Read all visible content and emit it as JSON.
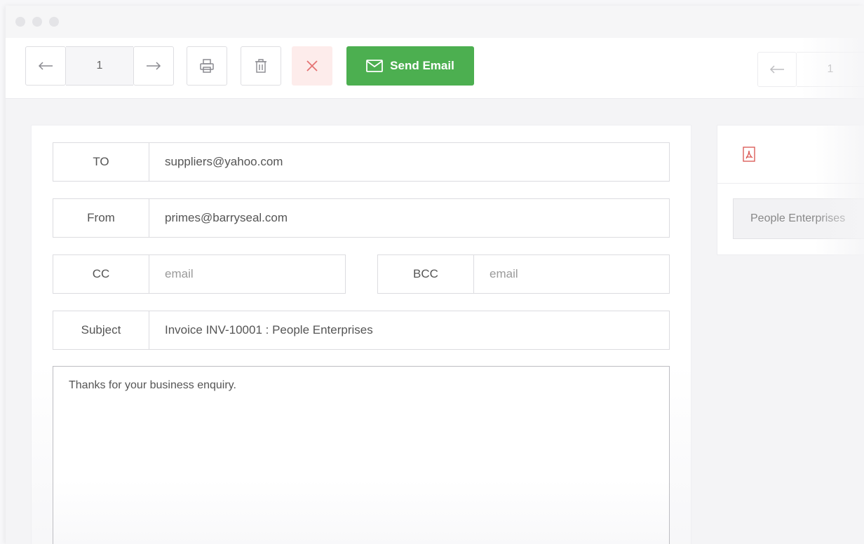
{
  "toolbar": {
    "page_number": "1",
    "send_label": "Send Email",
    "preview_page_number": "1"
  },
  "form": {
    "to": {
      "label": "TO",
      "value": "suppliers@yahoo.com"
    },
    "from": {
      "label": "From",
      "value": "primes@barryseal.com"
    },
    "cc": {
      "label": "CC",
      "placeholder": "email"
    },
    "bcc": {
      "label": "BCC",
      "placeholder": "email"
    },
    "subject": {
      "label": "Subject",
      "value": "Invoice INV-10001 : People Enterprises"
    },
    "body": "Thanks for your business enquiry."
  },
  "preview": {
    "company": "People Enterprises"
  },
  "colors": {
    "send_button": "#4caf50",
    "close_icon": "#e57373",
    "pdf_icon": "#d9534f"
  },
  "icons": [
    "arrow-left-icon",
    "arrow-right-icon",
    "printer-icon",
    "trash-icon",
    "close-icon",
    "envelope-icon",
    "pdf-icon"
  ]
}
